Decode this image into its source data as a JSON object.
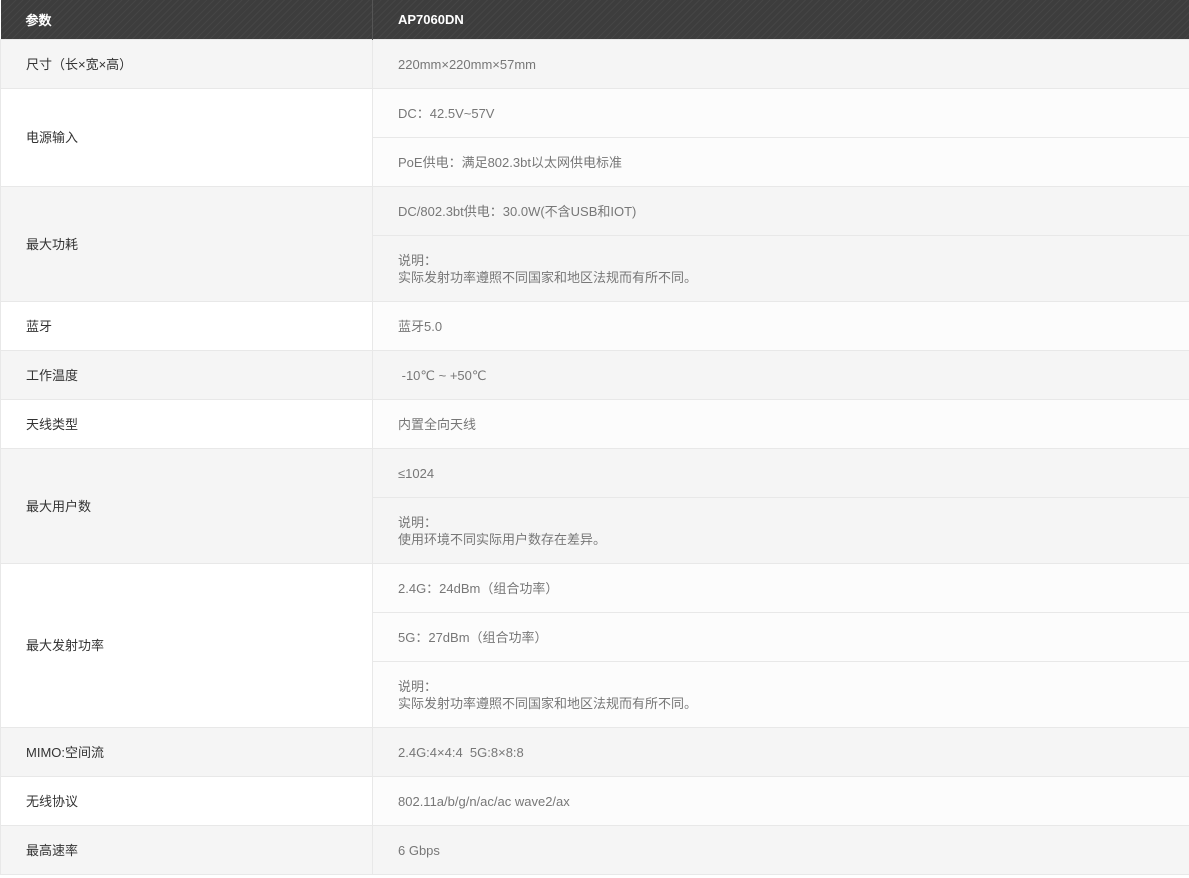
{
  "header": {
    "param_label": "参数",
    "model": "AP7060DN"
  },
  "rows": [
    {
      "label": "尺寸（长×宽×高）",
      "values": [
        "220mm×220mm×57mm"
      ]
    },
    {
      "label": "电源输入",
      "values": [
        "DC：42.5V~57V",
        "PoE供电：满足802.3bt以太网供电标准"
      ]
    },
    {
      "label": "最大功耗",
      "values": [
        "DC/802.3bt供电：30.0W(不含USB和IOT)"
      ],
      "note": {
        "title": "说明：",
        "text": "实际发射功率遵照不同国家和地区法规而有所不同。"
      }
    },
    {
      "label": "蓝牙",
      "values": [
        "蓝牙5.0"
      ]
    },
    {
      "label": "工作温度",
      "values": [
        " -10℃ ~ +50℃"
      ]
    },
    {
      "label": "天线类型",
      "values": [
        "内置全向天线"
      ]
    },
    {
      "label": "最大用户数",
      "values": [
        "≤1024"
      ],
      "note": {
        "title": "说明：",
        "text": "使用环境不同实际用户数存在差异。"
      }
    },
    {
      "label": "最大发射功率",
      "values": [
        "2.4G：24dBm（组合功率）",
        "5G：27dBm（组合功率）"
      ],
      "note": {
        "title": "说明：",
        "text": "实际发射功率遵照不同国家和地区法规而有所不同。"
      }
    },
    {
      "label": "MIMO:空间流",
      "values": [
        "2.4G:4×4:4  5G:8×8:8"
      ]
    },
    {
      "label": "无线协议",
      "values": [
        "802.11a/b/g/n/ac/ac wave2/ax"
      ]
    },
    {
      "label": "最高速率",
      "values": [
        "6 Gbps"
      ]
    }
  ]
}
